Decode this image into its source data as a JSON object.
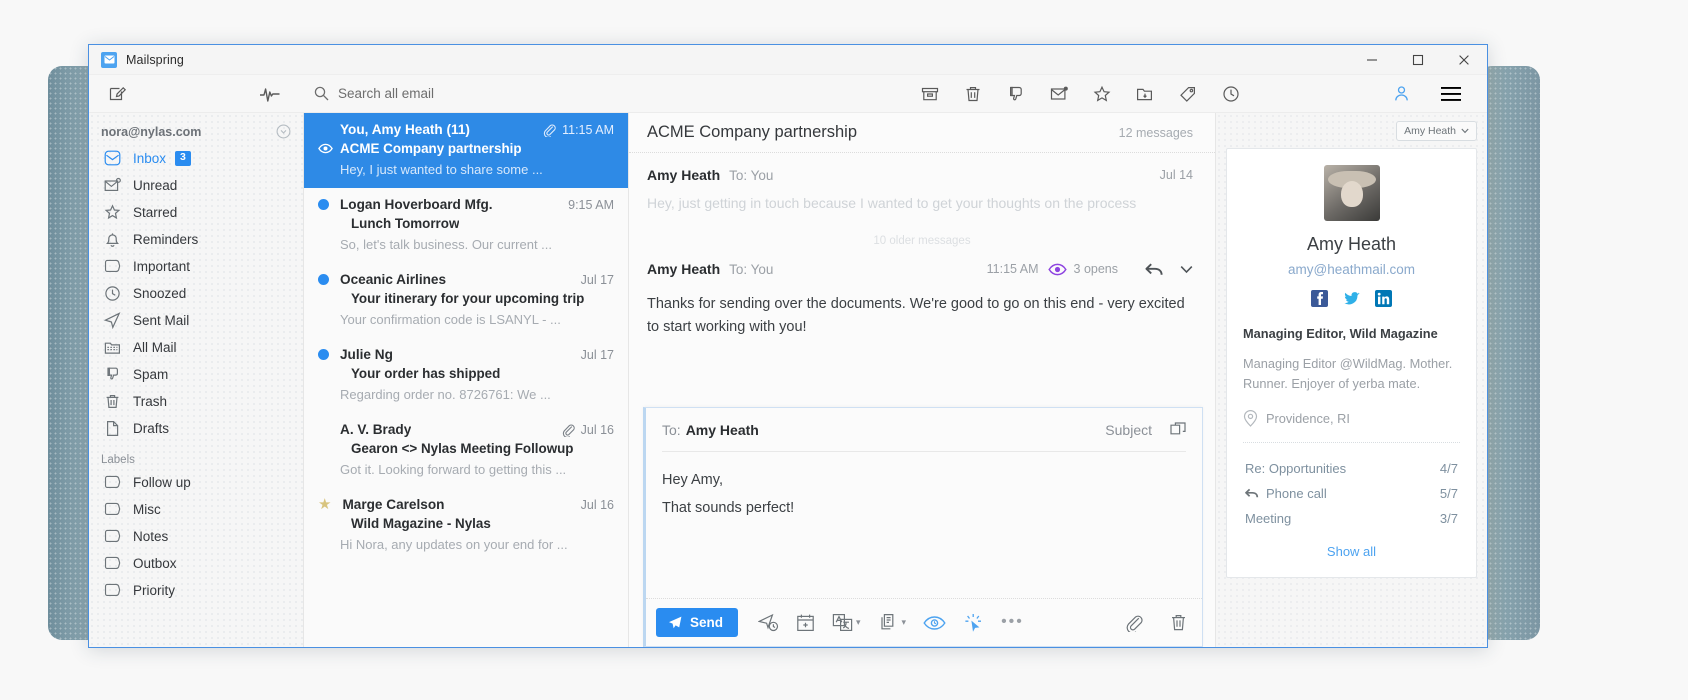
{
  "window": {
    "app_title": "Mailspring",
    "logo_icon": "envelope-logo-icon",
    "minimize_label": "–",
    "maximize_label": "☐",
    "close_label": "✕"
  },
  "toolbar": {
    "compose_icon": "compose-icon",
    "activity_icon": "activity-pulse-icon",
    "search_icon": "search-icon",
    "search_placeholder": "Search all email",
    "actions": [
      {
        "name": "archive-icon",
        "label": "Archive"
      },
      {
        "name": "trash-icon",
        "label": "Trash"
      },
      {
        "name": "spam-thumbs-down-icon",
        "label": "Mark as spam"
      },
      {
        "name": "mark-unread-envelope-icon",
        "label": "Mark as unread"
      },
      {
        "name": "star-icon",
        "label": "Star"
      },
      {
        "name": "move-to-folder-icon",
        "label": "Move to folder"
      },
      {
        "name": "tag-label-icon",
        "label": "Apply label"
      },
      {
        "name": "snooze-clock-icon",
        "label": "Snooze"
      }
    ],
    "person_icon": "person-account-icon",
    "hamburger_icon": "hamburger-menu-icon"
  },
  "sidebar": {
    "account_email": "nora@nylas.com",
    "account_chevron_icon": "chevron-down-circle-icon",
    "items": [
      {
        "label": "Inbox",
        "icon": "inbox-icon",
        "active": true,
        "badge": "3"
      },
      {
        "label": "Unread",
        "icon": "unread-envelope-icon",
        "active": false,
        "badge": ""
      },
      {
        "label": "Starred",
        "icon": "star-outline-icon",
        "active": false,
        "badge": ""
      },
      {
        "label": "Reminders",
        "icon": "bell-icon",
        "active": false,
        "badge": ""
      },
      {
        "label": "Important",
        "icon": "tag-outline-icon",
        "active": false,
        "badge": ""
      },
      {
        "label": "Snoozed",
        "icon": "clock-icon",
        "active": false,
        "badge": ""
      },
      {
        "label": "Sent Mail",
        "icon": "paper-plane-icon",
        "active": false,
        "badge": ""
      },
      {
        "label": "All Mail",
        "icon": "folder-icon",
        "active": false,
        "badge": ""
      },
      {
        "label": "Spam",
        "icon": "thumbs-down-icon",
        "active": false,
        "badge": ""
      },
      {
        "label": "Trash",
        "icon": "trash-icon",
        "active": false,
        "badge": ""
      },
      {
        "label": "Drafts",
        "icon": "document-icon",
        "active": false,
        "badge": ""
      }
    ],
    "labels_heading": "Labels",
    "labels": [
      {
        "label": "Follow up",
        "icon": "tag-outline-icon"
      },
      {
        "label": "Misc",
        "icon": "tag-outline-icon"
      },
      {
        "label": "Notes",
        "icon": "tag-outline-icon"
      },
      {
        "label": "Outbox",
        "icon": "tag-outline-icon"
      },
      {
        "label": "Priority",
        "icon": "tag-outline-icon"
      }
    ]
  },
  "message_list": [
    {
      "sender": "You, Amy Heath (11)",
      "subject": "ACME Company partnership",
      "snippet": "Hey, I just wanted to share some ...",
      "time": "11:15 AM",
      "selected": true,
      "unread": false,
      "starred": false,
      "attachment": true,
      "eye_icon": "eye-open-icon"
    },
    {
      "sender": "Logan Hoverboard Mfg.",
      "subject": "Lunch Tomorrow",
      "snippet": "So, let's talk business. Our current ...",
      "time": "9:15 AM",
      "selected": false,
      "unread": true,
      "starred": false,
      "attachment": false,
      "eye_icon": ""
    },
    {
      "sender": "Oceanic Airlines",
      "subject": "Your itinerary for your upcoming trip",
      "snippet": "Your confirmation code is LSANYL - ...",
      "time": "Jul 17",
      "selected": false,
      "unread": true,
      "starred": false,
      "attachment": false,
      "eye_icon": ""
    },
    {
      "sender": "Julie Ng",
      "subject": "Your order has shipped",
      "snippet": "Regarding order no. 8726761: We ...",
      "time": "Jul 17",
      "selected": false,
      "unread": true,
      "starred": false,
      "attachment": false,
      "eye_icon": ""
    },
    {
      "sender": "A. V. Brady",
      "subject": "Gearon <> Nylas Meeting Followup",
      "snippet": "Got it. Looking forward to getting this ...",
      "time": "Jul 16",
      "selected": false,
      "unread": false,
      "starred": false,
      "attachment": true,
      "eye_icon": ""
    },
    {
      "sender": "Marge Carelson",
      "subject": "Wild Magazine - Nylas",
      "snippet": "Hi Nora, any updates on your end for ...",
      "time": "Jul 16",
      "selected": false,
      "unread": false,
      "starred": true,
      "attachment": false,
      "eye_icon": ""
    }
  ],
  "thread": {
    "subject": "ACME Company partnership",
    "count_label": "12 messages",
    "older_divider_label": "10 older messages",
    "messages": [
      {
        "from": "Amy Heath",
        "to": "To: You",
        "date": "Jul 14",
        "body": "Hey, just getting in touch because I wanted to get your thoughts on the process",
        "collapsed": true,
        "opens": "",
        "opens_icon": ""
      },
      {
        "from": "Amy Heath",
        "to": "To: You",
        "date": "11:15 AM",
        "body": "Thanks for sending over the documents. We're good to go on this end - very excited to start working with you!",
        "collapsed": false,
        "opens": "3 opens",
        "opens_icon": "eye-opens-tracking-icon",
        "reply_icon": "reply-arrow-icon",
        "more_icon": "chevron-down-icon"
      }
    ]
  },
  "composer": {
    "to_label": "To:",
    "to_name": "Amy Heath",
    "subject_label": "Subject",
    "popout_icon": "popout-window-icon",
    "body_lines": [
      "Hey Amy,",
      "That sounds perfect!"
    ],
    "send_label": "Send",
    "send_icon": "paper-plane-icon",
    "send_color": "#2a8cf0",
    "tools": [
      {
        "name": "send-later-icon",
        "caret": false,
        "blue": false
      },
      {
        "name": "calendar-availability-icon",
        "caret": false,
        "blue": false
      },
      {
        "name": "translate-icon",
        "caret": true,
        "blue": false
      },
      {
        "name": "templates-icon",
        "caret": true,
        "blue": false
      },
      {
        "name": "read-receipts-eye-icon",
        "caret": false,
        "blue": true
      },
      {
        "name": "link-tracking-cursor-icon",
        "caret": false,
        "blue": true
      },
      {
        "name": "more-options-dots-icon",
        "caret": false,
        "blue": false
      }
    ],
    "attach_icon": "paperclip-icon",
    "discard_icon": "trash-icon"
  },
  "right_panel": {
    "chip_label": "Amy Heath",
    "chip_caret_icon": "chevron-down-icon",
    "avatar_name": "contact-avatar",
    "name": "Amy Heath",
    "email": "amy@heathmail.com",
    "socials": [
      {
        "name": "facebook-icon",
        "glyph": "f"
      },
      {
        "name": "twitter-icon",
        "glyph": ""
      },
      {
        "name": "linkedin-icon",
        "glyph": "in"
      }
    ],
    "title": "Managing Editor, Wild Magazine",
    "bio": "Managing Editor @WildMag. Mother. Runner. Enjoyer of yerba mate.",
    "location": "Providence, RI",
    "location_icon": "map-pin-icon",
    "links": [
      {
        "label": "Re: Opportunities",
        "count": "4/7",
        "icon": ""
      },
      {
        "label": "Phone call",
        "count": "5/7",
        "icon": "reply-arrow-icon"
      },
      {
        "label": "Meeting",
        "count": "3/7",
        "icon": ""
      }
    ],
    "show_all_label": "Show all",
    "accent_color": "#4da3f0"
  }
}
